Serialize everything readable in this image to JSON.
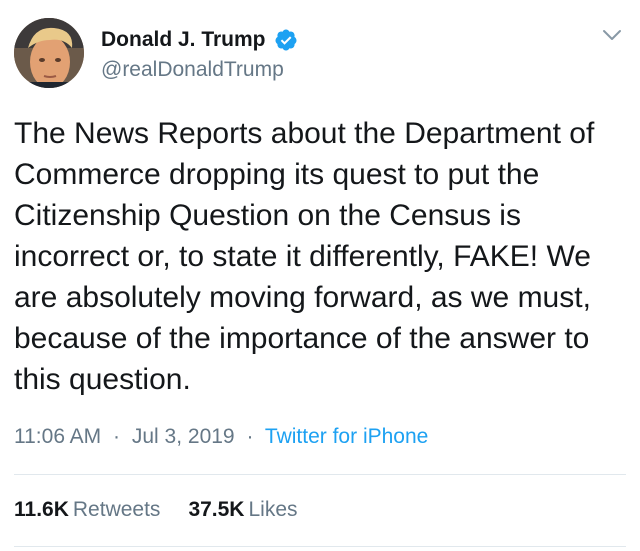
{
  "author": {
    "display_name": "Donald J. Trump",
    "handle": "@realDonaldTrump",
    "verified_icon": "verified-badge-icon",
    "avatar_icon": "profile-photo"
  },
  "menu": {
    "icon": "chevron-down-icon"
  },
  "tweet": {
    "text": "The News Reports about the Department of\nCommerce dropping its quest to put the\nCitizenship Question on the Census is\nincorrect or, to state it differently, FAKE! We\nare absolutely moving forward, as we must,\nbecause of the importance of the answer to\nthis question."
  },
  "meta": {
    "time": "11:06 AM",
    "separator": "·",
    "date": "Jul 3, 2019",
    "source": "Twitter for iPhone"
  },
  "stats": {
    "retweets_count": "11.6K",
    "retweets_label": "Retweets",
    "likes_count": "37.5K",
    "likes_label": "Likes"
  },
  "colors": {
    "text": "#14171a",
    "secondary": "#657786",
    "link": "#1da1f2",
    "divider": "#e1e8ed"
  }
}
